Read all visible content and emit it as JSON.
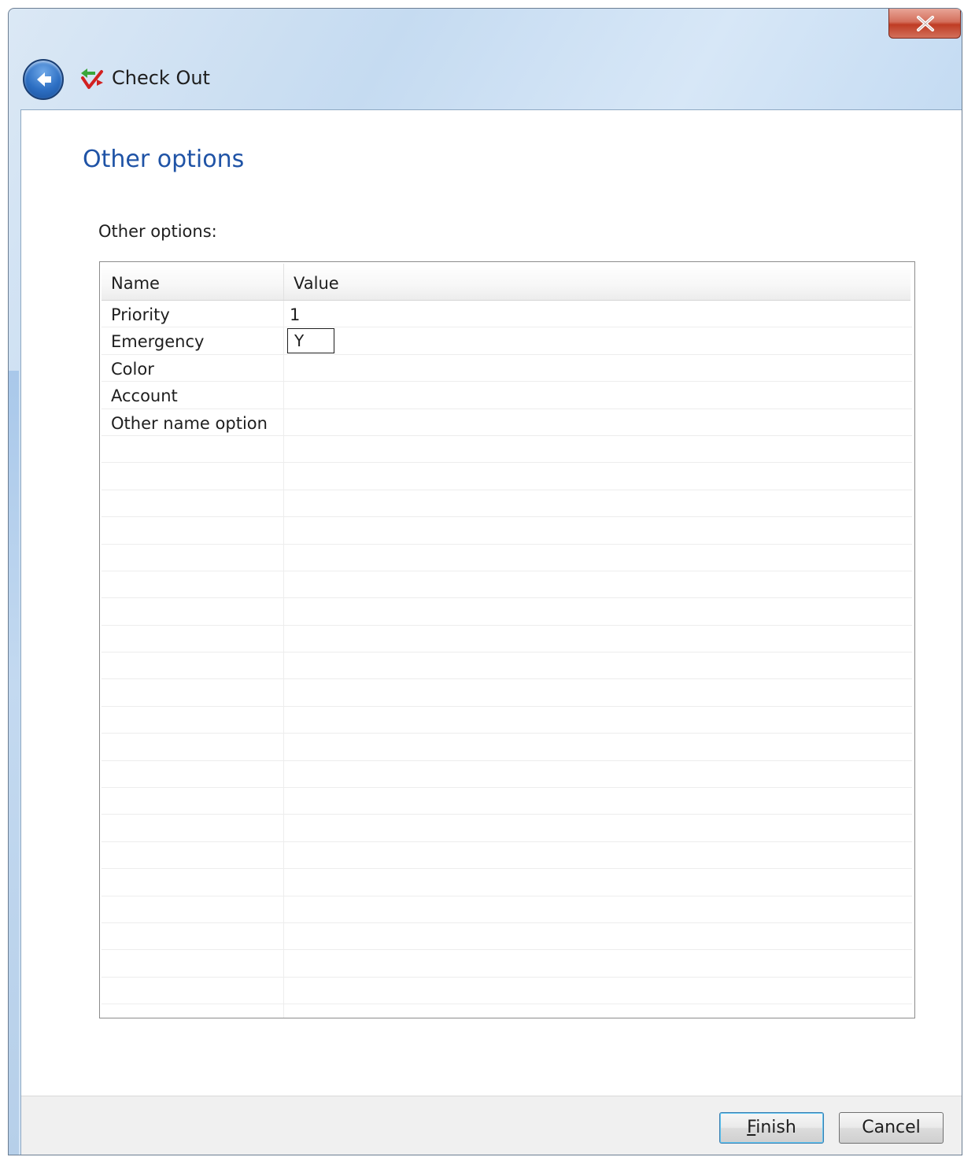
{
  "window": {
    "title": "Check Out",
    "close_label": "x"
  },
  "page": {
    "title": "Other options",
    "section_label": "Other options:"
  },
  "grid": {
    "columns": [
      "Name",
      "Value"
    ],
    "rows": [
      {
        "name": "Priority",
        "value": "1"
      },
      {
        "name": "Emergency",
        "value": "Y",
        "editing": true
      },
      {
        "name": "Color",
        "value": ""
      },
      {
        "name": "Account",
        "value": ""
      },
      {
        "name": "Other name option",
        "value": ""
      }
    ]
  },
  "buttons": {
    "finish_first": "F",
    "finish_rest": "inish",
    "cancel": "Cancel"
  },
  "colors": {
    "title_blue": "#1f53a6",
    "close_red": "#c0452f",
    "back_blue": "#2d6fc3"
  },
  "icons": {
    "back": "back-arrow-icon",
    "checkout": "checkout-arrows-icon",
    "close": "close-icon"
  }
}
